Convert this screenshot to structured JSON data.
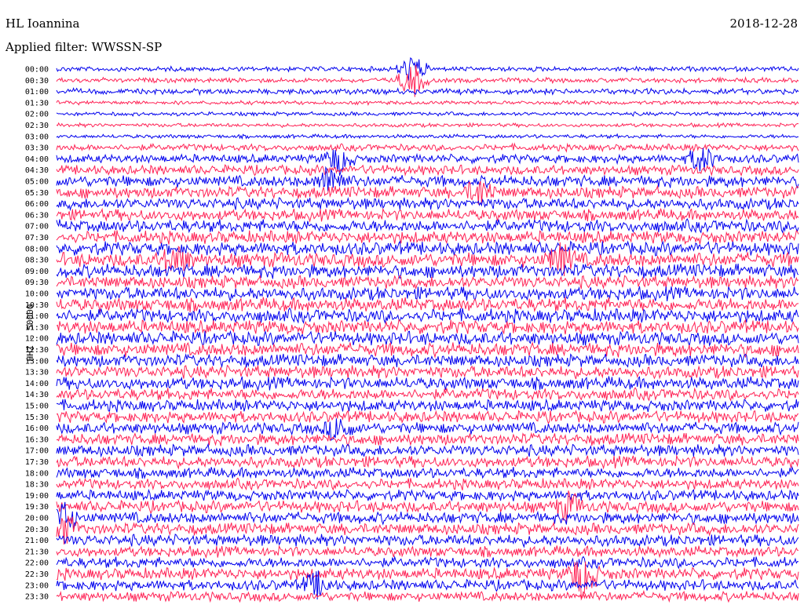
{
  "header": {
    "station": "HL Ioannina",
    "date": "2018-12-28",
    "filter": "Applied filter: WWSSN-SP",
    "channel": "HHZ - 50000"
  },
  "colors": {
    "trace_a": "#0000ee",
    "trace_b": "#ff2255",
    "background": "#ffffff"
  },
  "chart_data": {
    "type": "line",
    "title": "HL Ioannina",
    "ylabel": "HHZ - 50000",
    "row_labels": [
      "00:00",
      "00:30",
      "01:00",
      "01:30",
      "02:00",
      "02:30",
      "03:00",
      "03:30",
      "04:00",
      "04:30",
      "05:00",
      "05:30",
      "06:00",
      "06:30",
      "07:00",
      "07:30",
      "08:00",
      "08:30",
      "09:00",
      "09:30",
      "10:00",
      "10:30",
      "11:00",
      "11:30",
      "12:00",
      "12:30",
      "13:00",
      "13:30",
      "14:00",
      "14:30",
      "15:00",
      "15:30",
      "16:00",
      "16:30",
      "17:00",
      "17:30",
      "18:00",
      "18:30",
      "19:00",
      "19:30",
      "20:00",
      "20:30",
      "21:00",
      "21:30",
      "22:00",
      "22:30",
      "23:00",
      "23:30"
    ],
    "row_colors": [
      "trace_a",
      "trace_b"
    ],
    "row_amplitude": [
      0.25,
      0.25,
      0.3,
      0.2,
      0.2,
      0.2,
      0.2,
      0.35,
      0.45,
      0.5,
      0.6,
      0.6,
      0.6,
      0.6,
      0.65,
      0.65,
      0.7,
      0.75,
      0.7,
      0.65,
      0.7,
      0.7,
      0.7,
      0.7,
      0.7,
      0.7,
      0.65,
      0.65,
      0.65,
      0.6,
      0.6,
      0.6,
      0.6,
      0.6,
      0.6,
      0.6,
      0.55,
      0.55,
      0.55,
      0.6,
      0.6,
      0.6,
      0.6,
      0.55,
      0.55,
      0.6,
      0.55,
      0.5
    ],
    "events": [
      {
        "row": 0,
        "x": 0.48,
        "amp": 1.2
      },
      {
        "row": 1,
        "x": 0.48,
        "amp": 1.5
      },
      {
        "row": 8,
        "x": 0.38,
        "amp": 1.2
      },
      {
        "row": 8,
        "x": 0.87,
        "amp": 1.1
      },
      {
        "row": 10,
        "x": 0.37,
        "amp": 1.3
      },
      {
        "row": 11,
        "x": 0.57,
        "amp": 1.1
      },
      {
        "row": 17,
        "x": 0.16,
        "amp": 1.2
      },
      {
        "row": 17,
        "x": 0.68,
        "amp": 1.2
      },
      {
        "row": 32,
        "x": 0.38,
        "amp": 1.0
      },
      {
        "row": 39,
        "x": 0.69,
        "amp": 1.1
      },
      {
        "row": 40,
        "x": 0.01,
        "amp": 1.3
      },
      {
        "row": 41,
        "x": 0.01,
        "amp": 1.2
      },
      {
        "row": 45,
        "x": 0.71,
        "amp": 2.0
      },
      {
        "row": 46,
        "x": 0.35,
        "amp": 1.0
      }
    ]
  }
}
